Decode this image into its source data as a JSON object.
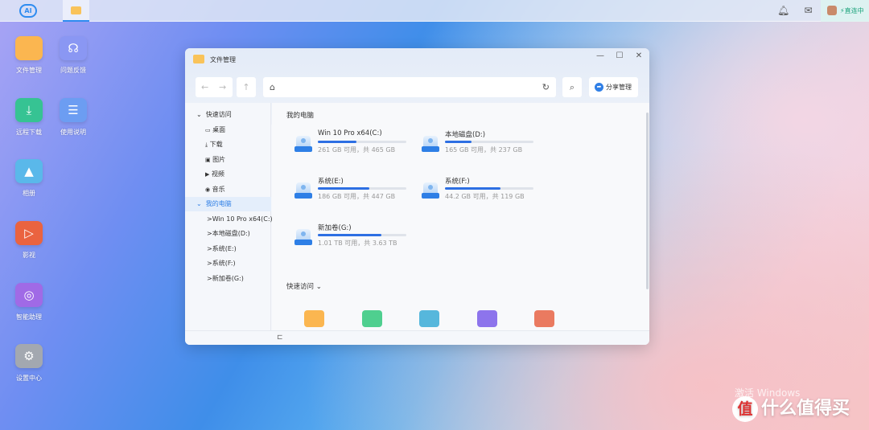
{
  "taskbar": {
    "logo": "AI",
    "status": "直连中",
    "icons": [
      "bell-icon",
      "inbox-icon"
    ]
  },
  "desktop": [
    {
      "label": "文件管理",
      "color": "#fbb650",
      "glyph": ""
    },
    {
      "label": "问题反馈",
      "color": "#8a97f3",
      "glyph": "☊"
    },
    {
      "label": "远程下载",
      "color": "#36c393",
      "glyph": "⤓"
    },
    {
      "label": "使用说明",
      "color": "#6c9df2",
      "glyph": "☰"
    },
    {
      "label": "相册",
      "color": "#5ab8ea",
      "glyph": "▲"
    },
    {
      "label": "影视",
      "color": "#ea6340",
      "glyph": "▷"
    },
    {
      "label": "智能助理",
      "color": "#a06ae6",
      "glyph": "◎"
    },
    {
      "label": "设置中心",
      "color": "#a3a8b0",
      "glyph": "⚙"
    }
  ],
  "window": {
    "title": "文件管理",
    "share_label": "分享管理",
    "sidebar": {
      "quick_access": "快速访问",
      "quick_items": [
        {
          "label": "桌面",
          "icon": "▭"
        },
        {
          "label": "下载",
          "icon": "⤓"
        },
        {
          "label": "图片",
          "icon": "▣"
        },
        {
          "label": "视频",
          "icon": "▶"
        },
        {
          "label": "音乐",
          "icon": "◉"
        }
      ],
      "my_computer": "我的电脑",
      "drives": [
        "Win 10 Pro x64(C:)",
        "本地磁盘(D:)",
        "系统(E:)",
        "系统(F:)",
        "新加卷(G:)"
      ]
    },
    "main": {
      "section_title": "我的电脑",
      "drives": [
        {
          "name": "Win 10 Pro x64(C:)",
          "info": "261 GB 可用，共 465 GB",
          "used": 0.44
        },
        {
          "name": "本地磁盘(D:)",
          "info": "165 GB 可用，共 237 GB",
          "used": 0.3
        },
        {
          "name": "系统(E:)",
          "info": "186 GB 可用，共 447 GB",
          "used": 0.58
        },
        {
          "name": "系统(F:)",
          "info": "44.2 GB 可用，共 119 GB",
          "used": 0.63
        },
        {
          "name": "新加卷(G:)",
          "info": "1.01 TB 可用，共 3.63 TB",
          "used": 0.72
        }
      ],
      "quick_title": "快速访问",
      "quick_folders": [
        {
          "name": "folder",
          "color": "#fbb650"
        },
        {
          "name": "download",
          "color": "#4fcf8f"
        },
        {
          "name": "picture",
          "color": "#56b7dc"
        },
        {
          "name": "video",
          "color": "#8d74ec"
        },
        {
          "name": "music",
          "color": "#ea7a60"
        }
      ]
    }
  },
  "watermark": {
    "activate": "激活 Windows",
    "brand": "什么值得买",
    "badge": "值"
  }
}
